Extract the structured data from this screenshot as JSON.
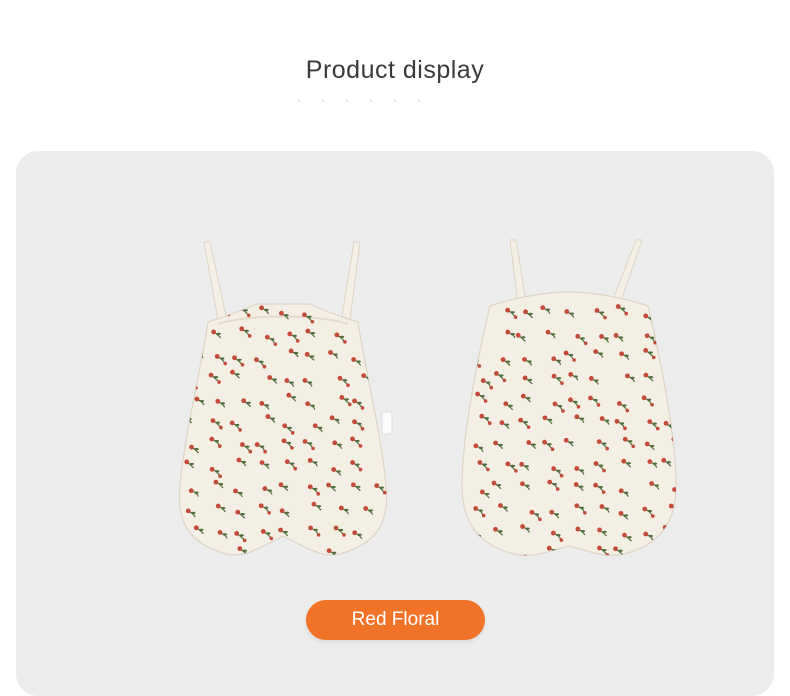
{
  "header": {
    "title": "Product display"
  },
  "product": {
    "images": [
      {
        "view": "front",
        "icon": "floral-bodysuit-front-icon"
      },
      {
        "view": "back",
        "icon": "floral-bodysuit-back-icon"
      }
    ],
    "color_button_label": "Red Floral"
  },
  "colors": {
    "panel_background": "#ececec",
    "button_background": "#f07328",
    "fabric": "#f4efe4",
    "flower": "#c44a3a",
    "leaf": "#4f6b3c"
  }
}
